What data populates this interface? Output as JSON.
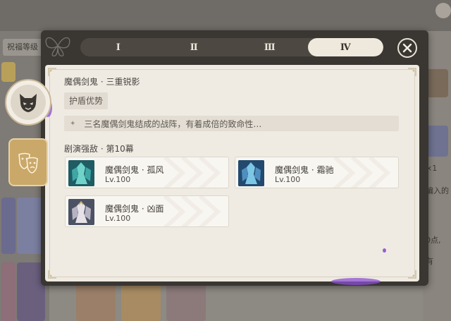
{
  "background": {
    "left_tab_label": "祝福等级",
    "right_texts": [
      "×1",
      "编入的",
      "0点,",
      "有"
    ]
  },
  "tabs": [
    {
      "label": "Ⅰ",
      "active": false
    },
    {
      "label": "Ⅱ",
      "active": false
    },
    {
      "label": "Ⅲ",
      "active": false
    },
    {
      "label": "Ⅳ",
      "active": true
    }
  ],
  "close_icon": "close-icon",
  "detail": {
    "title": "魔偶剑鬼 · 三重锐影",
    "badge": "护盾优势",
    "description": "三名魔偶剑鬼结成的战阵，有着成倍的致命性…",
    "section_title": "剧演强敌 · 第10幕",
    "enemies": [
      {
        "name": "魔偶剑鬼 · 孤风",
        "level": "Lv.100",
        "portrait": "teal"
      },
      {
        "name": "魔偶剑鬼 · 霜驰",
        "level": "Lv.100",
        "portrait": "blue"
      },
      {
        "name": "魔偶剑鬼 · 凶面",
        "level": "Lv.100",
        "portrait": "white"
      }
    ]
  },
  "colors": {
    "tab_active_bg": "#efe8dc",
    "modal_bg": "#3a3632",
    "card_bg": "#efebe3",
    "glow": "#8b4fd1"
  }
}
